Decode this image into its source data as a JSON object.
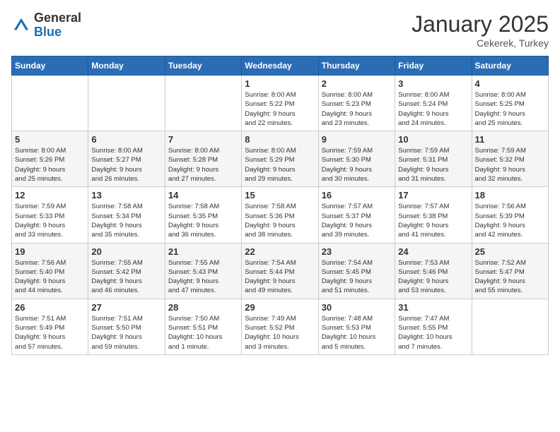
{
  "header": {
    "logo_general": "General",
    "logo_blue": "Blue",
    "month_title": "January 2025",
    "subtitle": "Cekerek, Turkey"
  },
  "weekdays": [
    "Sunday",
    "Monday",
    "Tuesday",
    "Wednesday",
    "Thursday",
    "Friday",
    "Saturday"
  ],
  "weeks": [
    [
      {
        "day": "",
        "info": ""
      },
      {
        "day": "",
        "info": ""
      },
      {
        "day": "",
        "info": ""
      },
      {
        "day": "1",
        "info": "Sunrise: 8:00 AM\nSunset: 5:22 PM\nDaylight: 9 hours\nand 22 minutes."
      },
      {
        "day": "2",
        "info": "Sunrise: 8:00 AM\nSunset: 5:23 PM\nDaylight: 9 hours\nand 23 minutes."
      },
      {
        "day": "3",
        "info": "Sunrise: 8:00 AM\nSunset: 5:24 PM\nDaylight: 9 hours\nand 24 minutes."
      },
      {
        "day": "4",
        "info": "Sunrise: 8:00 AM\nSunset: 5:25 PM\nDaylight: 9 hours\nand 25 minutes."
      }
    ],
    [
      {
        "day": "5",
        "info": "Sunrise: 8:00 AM\nSunset: 5:26 PM\nDaylight: 9 hours\nand 25 minutes."
      },
      {
        "day": "6",
        "info": "Sunrise: 8:00 AM\nSunset: 5:27 PM\nDaylight: 9 hours\nand 26 minutes."
      },
      {
        "day": "7",
        "info": "Sunrise: 8:00 AM\nSunset: 5:28 PM\nDaylight: 9 hours\nand 27 minutes."
      },
      {
        "day": "8",
        "info": "Sunrise: 8:00 AM\nSunset: 5:29 PM\nDaylight: 9 hours\nand 29 minutes."
      },
      {
        "day": "9",
        "info": "Sunrise: 7:59 AM\nSunset: 5:30 PM\nDaylight: 9 hours\nand 30 minutes."
      },
      {
        "day": "10",
        "info": "Sunrise: 7:59 AM\nSunset: 5:31 PM\nDaylight: 9 hours\nand 31 minutes."
      },
      {
        "day": "11",
        "info": "Sunrise: 7:59 AM\nSunset: 5:32 PM\nDaylight: 9 hours\nand 32 minutes."
      }
    ],
    [
      {
        "day": "12",
        "info": "Sunrise: 7:59 AM\nSunset: 5:33 PM\nDaylight: 9 hours\nand 33 minutes."
      },
      {
        "day": "13",
        "info": "Sunrise: 7:58 AM\nSunset: 5:34 PM\nDaylight: 9 hours\nand 35 minutes."
      },
      {
        "day": "14",
        "info": "Sunrise: 7:58 AM\nSunset: 5:35 PM\nDaylight: 9 hours\nand 36 minutes."
      },
      {
        "day": "15",
        "info": "Sunrise: 7:58 AM\nSunset: 5:36 PM\nDaylight: 9 hours\nand 38 minutes."
      },
      {
        "day": "16",
        "info": "Sunrise: 7:57 AM\nSunset: 5:37 PM\nDaylight: 9 hours\nand 39 minutes."
      },
      {
        "day": "17",
        "info": "Sunrise: 7:57 AM\nSunset: 5:38 PM\nDaylight: 9 hours\nand 41 minutes."
      },
      {
        "day": "18",
        "info": "Sunrise: 7:56 AM\nSunset: 5:39 PM\nDaylight: 9 hours\nand 42 minutes."
      }
    ],
    [
      {
        "day": "19",
        "info": "Sunrise: 7:56 AM\nSunset: 5:40 PM\nDaylight: 9 hours\nand 44 minutes."
      },
      {
        "day": "20",
        "info": "Sunrise: 7:55 AM\nSunset: 5:42 PM\nDaylight: 9 hours\nand 46 minutes."
      },
      {
        "day": "21",
        "info": "Sunrise: 7:55 AM\nSunset: 5:43 PM\nDaylight: 9 hours\nand 47 minutes."
      },
      {
        "day": "22",
        "info": "Sunrise: 7:54 AM\nSunset: 5:44 PM\nDaylight: 9 hours\nand 49 minutes."
      },
      {
        "day": "23",
        "info": "Sunrise: 7:54 AM\nSunset: 5:45 PM\nDaylight: 9 hours\nand 51 minutes."
      },
      {
        "day": "24",
        "info": "Sunrise: 7:53 AM\nSunset: 5:46 PM\nDaylight: 9 hours\nand 53 minutes."
      },
      {
        "day": "25",
        "info": "Sunrise: 7:52 AM\nSunset: 5:47 PM\nDaylight: 9 hours\nand 55 minutes."
      }
    ],
    [
      {
        "day": "26",
        "info": "Sunrise: 7:51 AM\nSunset: 5:49 PM\nDaylight: 9 hours\nand 57 minutes."
      },
      {
        "day": "27",
        "info": "Sunrise: 7:51 AM\nSunset: 5:50 PM\nDaylight: 9 hours\nand 59 minutes."
      },
      {
        "day": "28",
        "info": "Sunrise: 7:50 AM\nSunset: 5:51 PM\nDaylight: 10 hours\nand 1 minute."
      },
      {
        "day": "29",
        "info": "Sunrise: 7:49 AM\nSunset: 5:52 PM\nDaylight: 10 hours\nand 3 minutes."
      },
      {
        "day": "30",
        "info": "Sunrise: 7:48 AM\nSunset: 5:53 PM\nDaylight: 10 hours\nand 5 minutes."
      },
      {
        "day": "31",
        "info": "Sunrise: 7:47 AM\nSunset: 5:55 PM\nDaylight: 10 hours\nand 7 minutes."
      },
      {
        "day": "",
        "info": ""
      }
    ]
  ]
}
